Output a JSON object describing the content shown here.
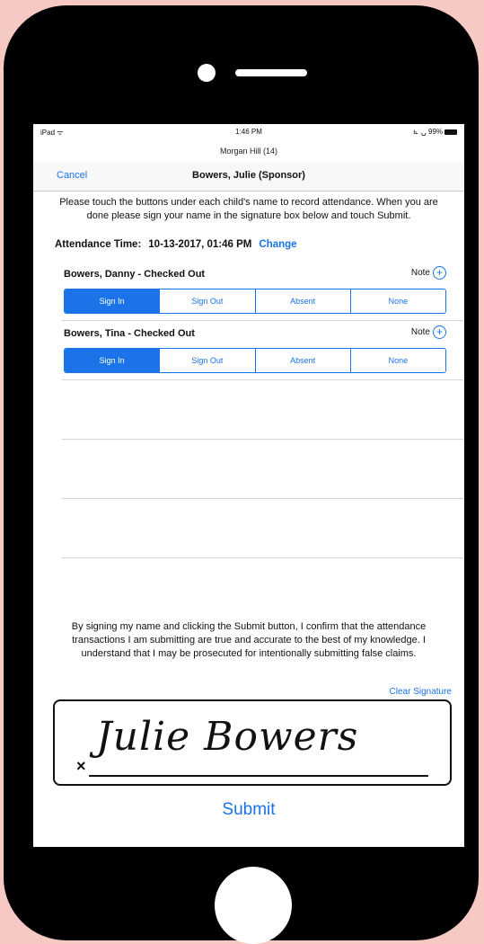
{
  "status_bar": {
    "left": "iPad ᯤ",
    "time": "1:46 PM",
    "right": "⊾ ⍽ 99%"
  },
  "subtitle": "Morgan Hill (14)",
  "nav": {
    "cancel": "Cancel",
    "title": "Bowers, Julie (Sponsor)"
  },
  "instructions": "Please touch the buttons under each child's name to record attendance.  When you are done please sign your name in the signature box below and touch Submit.",
  "attendance": {
    "label": "Attendance Time:",
    "value": "10-13-2017, 01:46 PM",
    "change": "Change"
  },
  "children": [
    {
      "name": "Bowers, Danny  - Checked Out",
      "note": "Note",
      "selected": "Sign In"
    },
    {
      "name": "Bowers, Tina  - Checked Out",
      "note": "Note",
      "selected": "Sign In"
    }
  ],
  "segments": [
    "Sign In",
    "Sign Out",
    "Absent",
    "None"
  ],
  "confirmation": "By signing my name and clicking the Submit button, I confirm that the attendance transactions I am submitting are true and accurate to the best of my knowledge. I understand that I may be prosecuted for intentionally submitting false claims.",
  "clear_signature": "Clear Signature",
  "signature": {
    "x_mark": "×",
    "text": "Julie Bowers"
  },
  "submit": "Submit",
  "colors": {
    "accent": "#1a73e8",
    "background": "#f7c9c4",
    "phone": "#000000"
  }
}
